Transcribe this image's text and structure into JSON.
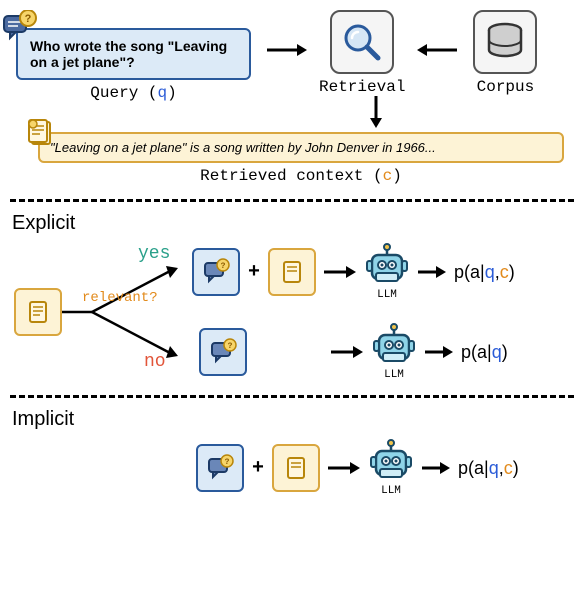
{
  "top": {
    "query_text": "Who wrote the song \"Leaving on a jet plane\"?",
    "query_label_pre": "Query (",
    "query_var": "q",
    "query_label_post": ")",
    "retrieval_label": "Retrieval",
    "corpus_label": "Corpus",
    "context_text": "\"Leaving on a jet plane\" is a song written by John Denver in 1966...",
    "context_label_pre": "Retrieved context (",
    "context_var": "c",
    "context_label_post": ")"
  },
  "explicit": {
    "title": "Explicit",
    "relevant_label": "relevant?",
    "yes_label": "yes",
    "no_label": "no",
    "llm_label": "LLM",
    "prob_yes_pre": "p(a|",
    "prob_yes_q": "q",
    "prob_yes_comma": ",",
    "prob_yes_c": "c",
    "prob_yes_post": ")",
    "prob_no_pre": "p(a|",
    "prob_no_q": "q",
    "prob_no_post": ")"
  },
  "implicit": {
    "title": "Implicit",
    "llm_label": "LLM",
    "prob_pre": "p(a|",
    "prob_q": "q",
    "prob_comma": ",",
    "prob_c": "c",
    "prob_post": ")"
  },
  "icons": {
    "chat": "chat-question-icon",
    "doc": "document-icon",
    "magnifier": "magnifier-icon",
    "db": "database-icon",
    "robot": "robot-icon"
  }
}
